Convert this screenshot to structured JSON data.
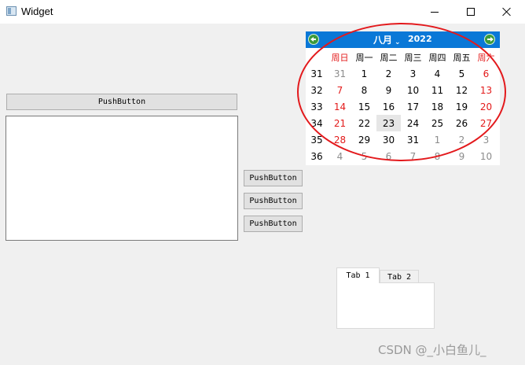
{
  "window": {
    "title": "Widget",
    "icon": "app-window-icon",
    "controls": [
      "minimize-icon",
      "maximize-icon",
      "close-icon"
    ]
  },
  "buttons": {
    "top": "PushButton",
    "right_1": "PushButton",
    "right_2": "PushButton",
    "right_3": "PushButton"
  },
  "text_edit": {
    "value": ""
  },
  "calendar": {
    "month": "八月",
    "month_arrow": "⌄",
    "year": "2022",
    "nav_prev_icon": "green-left-arrow-icon",
    "nav_next_icon": "green-right-arrow-icon",
    "header_color": "#0a78d7",
    "weekday_headers": [
      "周日",
      "周一",
      "周二",
      "周三",
      "周四",
      "周五",
      "周六"
    ],
    "weeks": [
      {
        "week": "31",
        "days": [
          "31",
          "1",
          "2",
          "3",
          "4",
          "5",
          "6"
        ]
      },
      {
        "week": "32",
        "days": [
          "7",
          "8",
          "9",
          "10",
          "11",
          "12",
          "13"
        ]
      },
      {
        "week": "33",
        "days": [
          "14",
          "15",
          "16",
          "17",
          "18",
          "19",
          "20"
        ]
      },
      {
        "week": "34",
        "days": [
          "21",
          "22",
          "23",
          "24",
          "25",
          "26",
          "27"
        ]
      },
      {
        "week": "35",
        "days": [
          "28",
          "29",
          "30",
          "31",
          "1",
          "2",
          "3"
        ]
      },
      {
        "week": "36",
        "days": [
          "4",
          "5",
          "6",
          "7",
          "8",
          "9",
          "10"
        ]
      }
    ],
    "selected_day": "23",
    "weekend_color": "#e31b1b",
    "annotation_color": "#e3191c"
  },
  "tabs": {
    "tab1": "Tab 1",
    "tab2": "Tab 2",
    "active": "Tab 1"
  },
  "watermark": "CSDN @_小白鱼儿_"
}
